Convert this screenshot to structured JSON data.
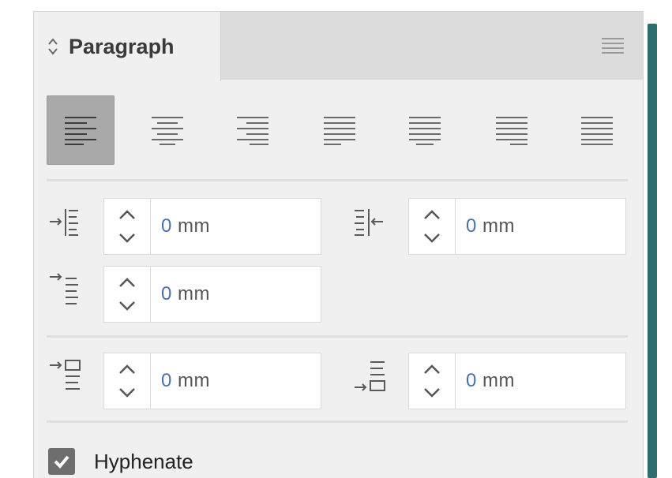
{
  "panel": {
    "title": "Paragraph",
    "tab_icon": "up-down-chevron-icon",
    "menu_icon": "hamburger-menu-icon"
  },
  "alignment": {
    "options": [
      {
        "name": "align-left",
        "active": true
      },
      {
        "name": "align-center",
        "active": false
      },
      {
        "name": "align-right",
        "active": false
      },
      {
        "name": "justify-last-left",
        "active": false
      },
      {
        "name": "justify-last-center",
        "active": false
      },
      {
        "name": "justify-last-right",
        "active": false
      },
      {
        "name": "justify-all",
        "active": false
      }
    ]
  },
  "indents": {
    "left_indent": "0 mm",
    "right_indent": "0 mm",
    "first_line_indent": "0 mm"
  },
  "spacing": {
    "space_before": "0 mm",
    "space_after": "0 mm"
  },
  "hyphenate": {
    "label": "Hyphenate",
    "checked": true
  },
  "colors": {
    "panel_bg": "#f0f0f0",
    "active_button": "#a9a9a9",
    "accent_shadow": "#2f6e6e"
  }
}
